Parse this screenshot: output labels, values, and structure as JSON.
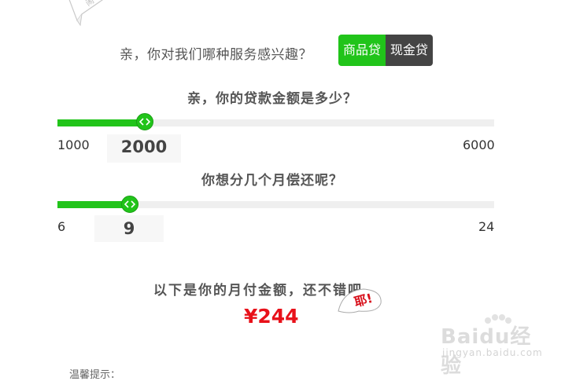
{
  "service": {
    "question": "亲，你对我们哪种服务感兴趣？",
    "options": [
      "商品贷",
      "现金贷"
    ],
    "selected": "商品贷",
    "active_color": "#21c41a",
    "inactive_color": "#444444"
  },
  "amount": {
    "question": "亲，你的贷款金额是多少？",
    "min": "1000",
    "max": "6000",
    "value": "2000",
    "fill_fraction": 0.2
  },
  "months": {
    "question": "你想分几个月偿还呢？",
    "min": "6",
    "max": "24",
    "value": "9",
    "fill_fraction": 0.1667
  },
  "result": {
    "label": "以下是你的月付金额，还不错吧。",
    "value": "¥244",
    "color": "#e8111a"
  },
  "bubble": {
    "text": "耶!"
  },
  "tip": {
    "text": "温馨提示："
  },
  "watermark": {
    "brand": "Baidu经验",
    "url": "jingyan.baidu.com"
  },
  "icons": {
    "slider_thumb": "left-right-arrows-icon",
    "sticker": "corner-sticker-icon",
    "bubble": "speech-bubble-icon"
  }
}
